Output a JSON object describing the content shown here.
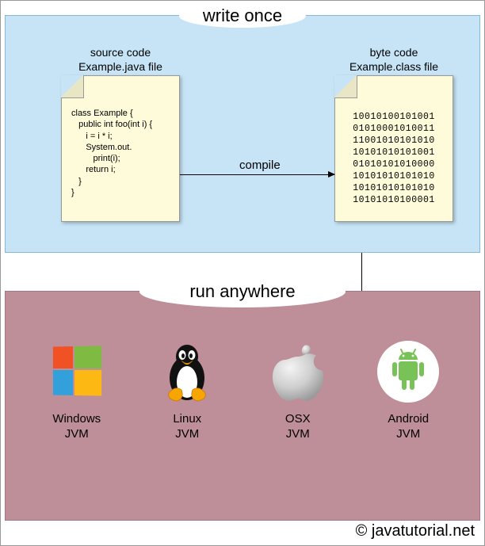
{
  "sections": {
    "top_title": "write once",
    "bottom_title": "run anywhere"
  },
  "source_file": {
    "caption_line1": "source code",
    "caption_line2": "Example.java file",
    "code": "class Example {\n   public int foo(int i) {\n      i = i * i;\n      System.out.\n         print(i);\n      return i;\n   }\n}"
  },
  "byte_file": {
    "caption_line1": "byte code",
    "caption_line2": "Example.class file",
    "binary": "10010100101001\n01010001010011\n11001010101010\n10101010101001\n01010101010000\n10101010101010\n10101010101010\n10101010100001"
  },
  "arrow_label": "compile",
  "platforms": [
    {
      "name": "Windows",
      "sub": "JVM",
      "icon": "windows"
    },
    {
      "name": "Linux",
      "sub": "JVM",
      "icon": "linux"
    },
    {
      "name": "OSX",
      "sub": "JVM",
      "icon": "apple"
    },
    {
      "name": "Android",
      "sub": "JVM",
      "icon": "android"
    }
  ],
  "copyright": "© javatutorial.net"
}
